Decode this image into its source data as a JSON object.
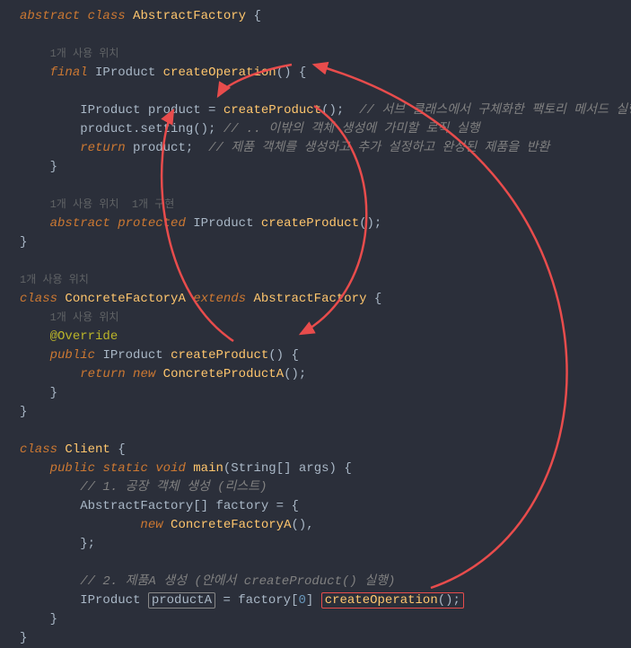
{
  "code": {
    "l1": {
      "abstract": "abstract",
      "class": "class",
      "name": "AbstractFactory",
      "brace": " {"
    },
    "l2": {
      "hint": "1개 사용 위치"
    },
    "l3": {
      "final": "final",
      "type": "IProduct",
      "method": "createOperation",
      "parens": "() {"
    },
    "l4": {
      "type": "IProduct",
      "var": "product",
      "eq": " = ",
      "call": "createProduct",
      "after": "();",
      "comment": "  // 서브 클래스에서 구체화한 팩토리 메서드 실행"
    },
    "l5": {
      "expr": "product.setting();",
      "comment": " // .. 이밖의 객체 생성에 가미할 로직 실행"
    },
    "l6": {
      "ret": "return",
      "var": " product;",
      "comment": "  // 제품 객체를 생성하고 추가 설정하고 완성된 제품을 반환"
    },
    "l7": {
      "brace": "}"
    },
    "l8a": {
      "hint1": "1개 사용 위치",
      "hint2": "  1개 구현"
    },
    "l8": {
      "abstract": "abstract",
      "protected": "protected",
      "type": "IProduct",
      "method": "createProduct",
      "after": "();"
    },
    "l9": {
      "brace": "}"
    },
    "l10": {
      "hint": "1개 사용 위치"
    },
    "l11": {
      "class": "class",
      "name": "ConcreteFactoryA",
      "extends": "extends",
      "parent": "AbstractFactory",
      "brace": " {"
    },
    "l11b": {
      "hint": "1개 사용 위치"
    },
    "l12": {
      "ann": "@Override"
    },
    "l13": {
      "public": "public",
      "type": "IProduct",
      "method": "createProduct",
      "parens": "() {"
    },
    "l14": {
      "ret": "return",
      "new": "new",
      "cls": "ConcreteProductA",
      "after": "();"
    },
    "l15": {
      "brace": "}"
    },
    "l16": {
      "brace": "}"
    },
    "l17": {
      "class": "class",
      "name": "Client",
      "brace": " {"
    },
    "l18": {
      "public": "public",
      "static": "static",
      "void": "void",
      "method": "main",
      "args": "(String[] args) {"
    },
    "l19": {
      "comment": "// 1. 공장 객체 생성 (리스트)"
    },
    "l20": {
      "type": "AbstractFactory[]",
      "var": "factory",
      "eq": " = {"
    },
    "l21": {
      "new": "new",
      "cls": "ConcreteFactoryA",
      "after": "(),"
    },
    "l22": {
      "brace": "};"
    },
    "l23": {
      "comment": "// 2. 제품A 생성 (안에서 createProduct() 실행)"
    },
    "l24": {
      "type": "IProduct",
      "var": "productA",
      "eq": " = factory[",
      "idx": "0",
      "br": "] ",
      "call": "createOperation",
      "after": "();"
    },
    "l25": {
      "brace": "}"
    },
    "l26": {
      "brace": "}"
    }
  }
}
